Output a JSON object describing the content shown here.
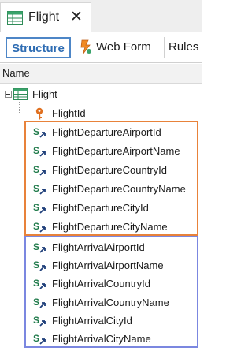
{
  "tab": {
    "title": "Flight",
    "close_glyph": "✕",
    "icon": "grid-table-icon"
  },
  "subtabs": {
    "structure": "Structure",
    "webform": "Web Form",
    "rules": "Rules"
  },
  "columns": {
    "name": "Name"
  },
  "tree": {
    "root_label": "Flight",
    "key_item": "FlightId",
    "departure_items": [
      "FlightDepartureAirportId",
      "FlightDepartureAirportName",
      "FlightDepartureCountryId",
      "FlightDepartureCountryName",
      "FlightDepartureCityId",
      "FlightDepartureCityName"
    ],
    "arrival_items": [
      "FlightArrivalAirportId",
      "FlightArrivalAirportName",
      "FlightArrivalCountryId",
      "FlightArrivalCountryName",
      "FlightArrivalCityId",
      "FlightArrivalCityName"
    ]
  },
  "colors": {
    "departure_box": "#e8823a",
    "arrival_box": "#7b87e0",
    "active_tab": "#2f6db3",
    "key_icon": "#e07020",
    "subtype_s": "#1f7a4a"
  }
}
